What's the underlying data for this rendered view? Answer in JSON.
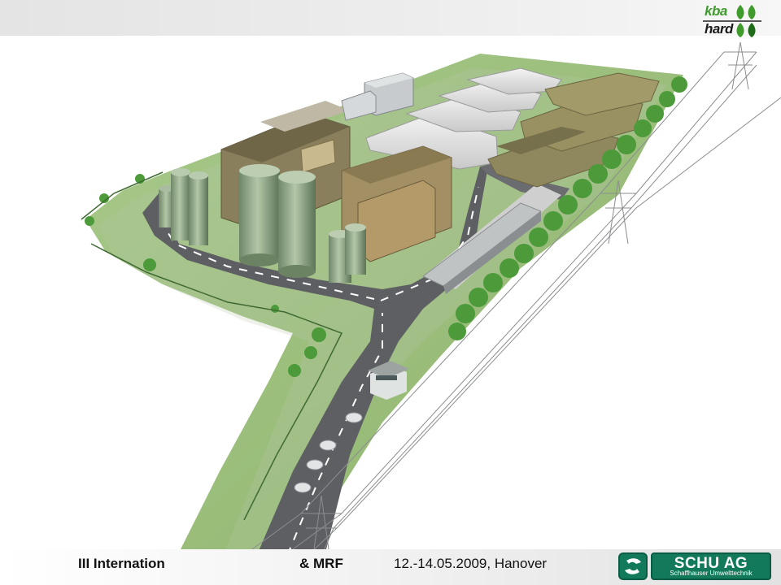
{
  "header": {
    "logo_kba": "kba",
    "logo_hard": "hard",
    "logo_colors": {
      "green": "#3e9b2c",
      "dark": "#1a1a1a"
    }
  },
  "scene": {
    "icon": "industrial-plant-aerial-render"
  },
  "footer": {
    "conference_title": "III Internation",
    "conference_suffix": "& MRF",
    "date_location": "12.-14.05.2009, Hanover",
    "company_name": "SCHU AG",
    "company_subtitle": "Schaffhauser Umwelttechnik",
    "company_color": "#127a5b"
  }
}
